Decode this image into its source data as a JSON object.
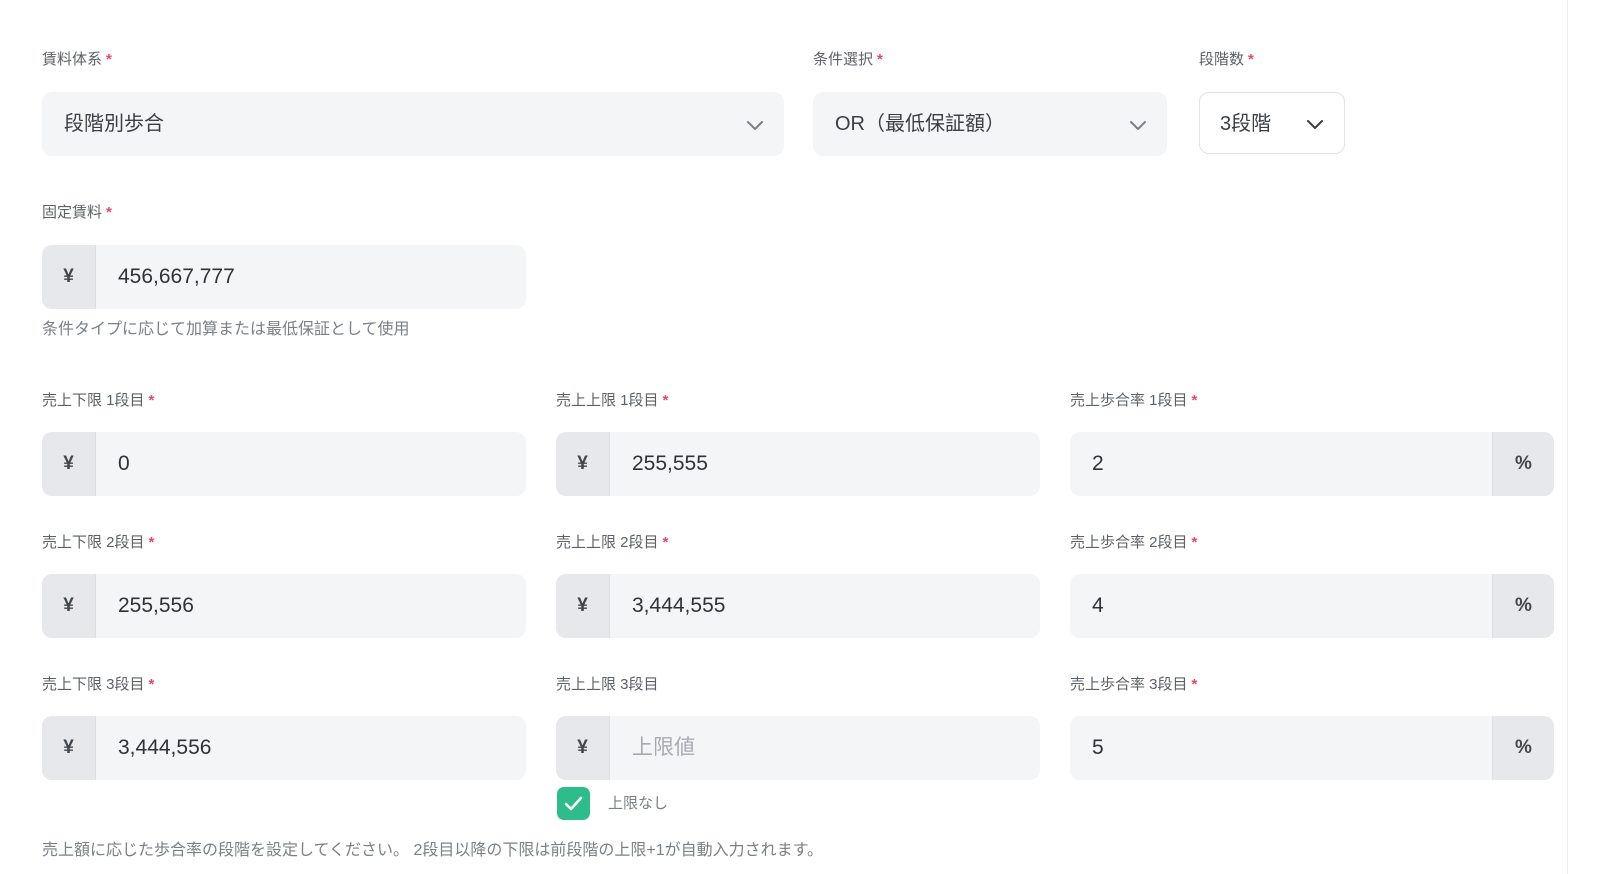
{
  "rent_type": {
    "label": "賃料体系",
    "value": "段階別歩合"
  },
  "condition": {
    "label": "条件選択",
    "value": "OR（最低保証額）"
  },
  "steps": {
    "label": "段階数",
    "value": "3段階"
  },
  "required_mark": "*",
  "fixed_rent": {
    "label": "固定賃料",
    "prefix": "¥",
    "value": "456,667,777",
    "helper": "条件タイプに応じて加算または最低保証として使用"
  },
  "tiers": [
    {
      "lower": {
        "label": "売上下限 1段目",
        "prefix": "¥",
        "value": "0"
      },
      "upper": {
        "label": "売上上限 1段目",
        "prefix": "¥",
        "value": "255,555"
      },
      "rate": {
        "label": "売上歩合率 1段目",
        "value": "2",
        "suffix": "%"
      }
    },
    {
      "lower": {
        "label": "売上下限 2段目",
        "prefix": "¥",
        "value": "255,556"
      },
      "upper": {
        "label": "売上上限 2段目",
        "prefix": "¥",
        "value": "3,444,555"
      },
      "rate": {
        "label": "売上歩合率 2段目",
        "value": "4",
        "suffix": "%"
      }
    },
    {
      "lower": {
        "label": "売上下限 3段目",
        "prefix": "¥",
        "value": "3,444,556"
      },
      "upper": {
        "label": "売上上限 3段目",
        "prefix": "¥",
        "value": "",
        "placeholder": "上限値"
      },
      "rate": {
        "label": "売上歩合率 3段目",
        "value": "5",
        "suffix": "%"
      }
    }
  ],
  "no_upper_limit": {
    "label": "上限なし",
    "checked": true
  },
  "footer_helper": "売上額に応じた歩合率の段階を設定してください。 2段目以降の下限は前段階の上限+1が自動入力されます。",
  "colors": {
    "required": "#e5476c",
    "checkbox": "#2ebd8a"
  }
}
